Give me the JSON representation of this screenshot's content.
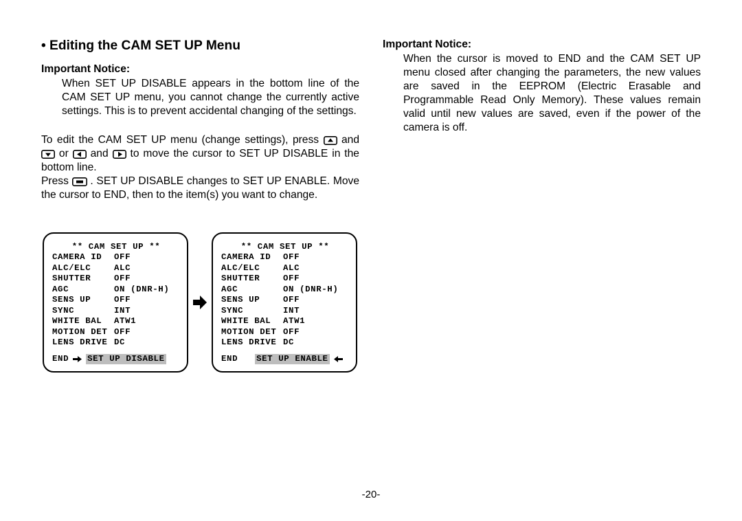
{
  "heading": "• Editing the CAM SET UP Menu",
  "left": {
    "notice_label": "Important Notice:",
    "notice_body": "When SET UP DISABLE appears in the bottom line of the CAM SET UP menu, you cannot change the currently active settings. This is to prevent accidental changing of the settings.",
    "para1_a": "To edit the CAM SET UP menu (change settings), press ",
    "para1_b": " and ",
    "para1_c": " or ",
    "para1_d": " and ",
    "para1_e": " to move the cursor to SET UP DISABLE in the bottom line.",
    "para2_a": "Press ",
    "para2_b": ". SET UP DISABLE changes to SET UP ENABLE. Move the cursor to END, then to the item(s) you want to change."
  },
  "right": {
    "notice_label": "Important Notice:",
    "notice_body": "When the cursor is moved to END and the CAM SET UP menu closed after changing the parameters, the new values are saved in the EEPROM (Electric Erasable and Programmable Read Only Memory). These values remain valid until new values are saved, even if the power of the camera is off."
  },
  "screen": {
    "title": "** CAM SET UP **",
    "rows": [
      {
        "k": "CAMERA ID",
        "v": "OFF"
      },
      {
        "k": "ALC/ELC",
        "v": "ALC"
      },
      {
        "k": "SHUTTER",
        "v": "OFF"
      },
      {
        "k": "AGC",
        "v": "ON (DNR-H)"
      },
      {
        "k": "SENS UP",
        "v": "OFF"
      },
      {
        "k": "SYNC",
        "v": "INT"
      },
      {
        "k": "WHITE BAL",
        "v": "ATW1"
      },
      {
        "k": "MOTION DET",
        "v": "OFF"
      },
      {
        "k": "LENS DRIVE",
        "v": "DC"
      }
    ],
    "end": "END",
    "disable": "SET UP DISABLE",
    "enable": "SET UP ENABLE"
  },
  "page_num": "-20-"
}
